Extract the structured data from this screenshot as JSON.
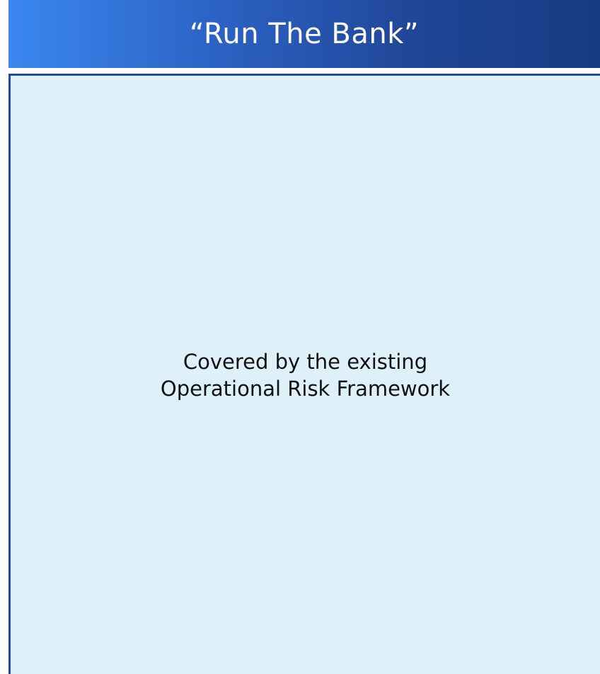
{
  "header": {
    "title": "“Run The Bank”"
  },
  "panel": {
    "lines": [
      "Covered by the existing",
      "Operational Risk Framework"
    ]
  },
  "colors": {
    "header_gradient_start": "#3a87f0",
    "header_gradient_end": "#183a82",
    "panel_background": "#def1fb",
    "panel_border": "#1c4aa8",
    "title_text": "#ffffff",
    "body_text": "#111111"
  }
}
